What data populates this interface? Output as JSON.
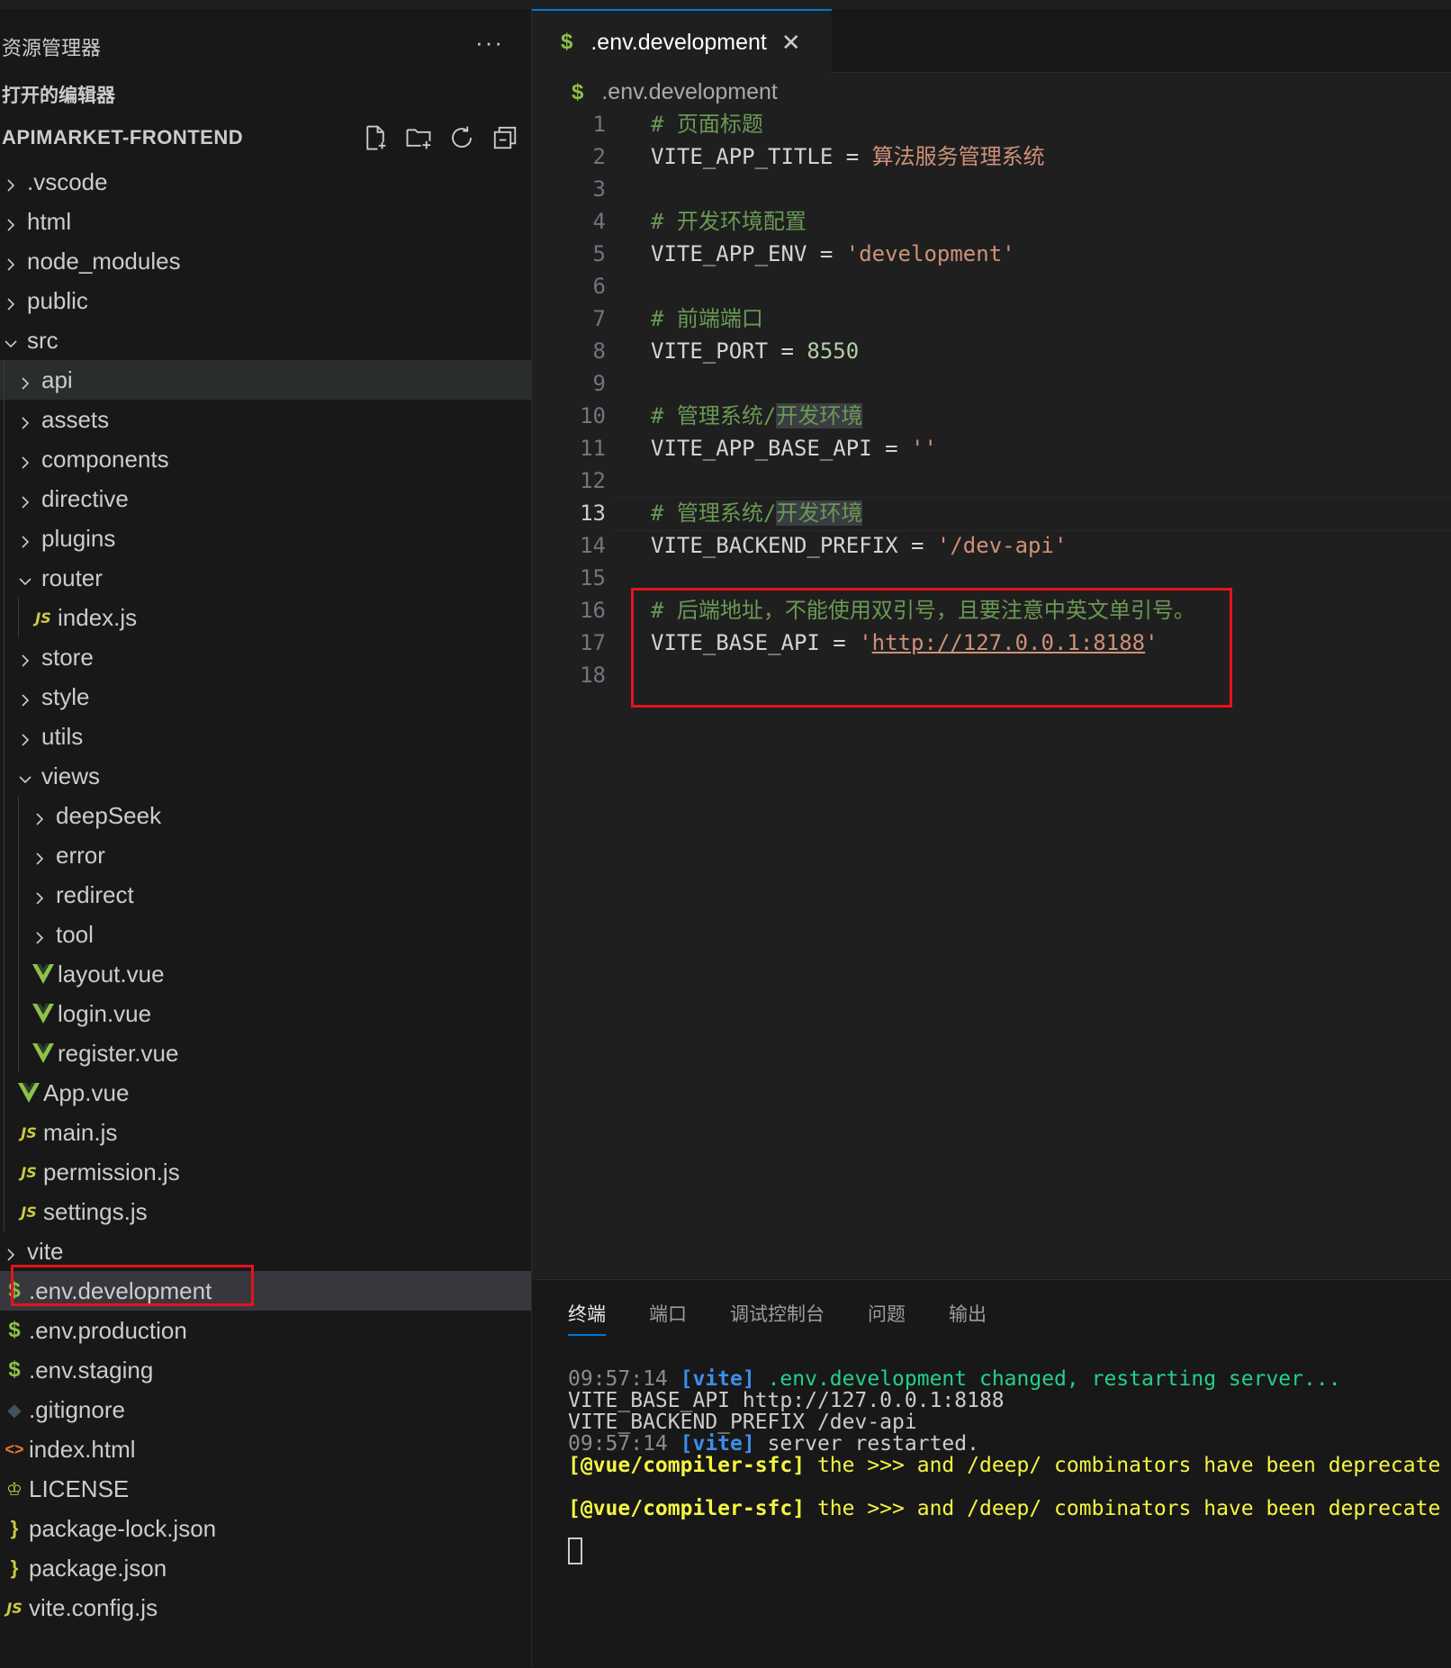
{
  "sidebar": {
    "title": "资源管理器",
    "more": "···",
    "open_editors": "打开的编辑器",
    "project": "APIMARKET-FRONTEND",
    "actions": [
      "new-file-icon",
      "new-folder-icon",
      "refresh-icon",
      "collapse-all-icon"
    ],
    "tree": [
      {
        "label": ".vscode",
        "type": "folder",
        "open": false,
        "depth": 0
      },
      {
        "label": "html",
        "type": "folder",
        "open": false,
        "depth": 0
      },
      {
        "label": "node_modules",
        "type": "folder",
        "open": false,
        "depth": 0
      },
      {
        "label": "public",
        "type": "folder",
        "open": false,
        "depth": 0
      },
      {
        "label": "src",
        "type": "folder",
        "open": true,
        "depth": 0
      },
      {
        "label": "api",
        "type": "folder",
        "open": false,
        "depth": 1,
        "hover": true
      },
      {
        "label": "assets",
        "type": "folder",
        "open": false,
        "depth": 1
      },
      {
        "label": "components",
        "type": "folder",
        "open": false,
        "depth": 1
      },
      {
        "label": "directive",
        "type": "folder",
        "open": false,
        "depth": 1
      },
      {
        "label": "plugins",
        "type": "folder",
        "open": false,
        "depth": 1
      },
      {
        "label": "router",
        "type": "folder",
        "open": true,
        "depth": 1
      },
      {
        "label": "index.js",
        "type": "js",
        "depth": 2
      },
      {
        "label": "store",
        "type": "folder",
        "open": false,
        "depth": 1
      },
      {
        "label": "style",
        "type": "folder",
        "open": false,
        "depth": 1
      },
      {
        "label": "utils",
        "type": "folder",
        "open": false,
        "depth": 1
      },
      {
        "label": "views",
        "type": "folder",
        "open": true,
        "depth": 1
      },
      {
        "label": "deepSeek",
        "type": "folder",
        "open": false,
        "depth": 2
      },
      {
        "label": "error",
        "type": "folder",
        "open": false,
        "depth": 2
      },
      {
        "label": "redirect",
        "type": "folder",
        "open": false,
        "depth": 2
      },
      {
        "label": "tool",
        "type": "folder",
        "open": false,
        "depth": 2
      },
      {
        "label": "layout.vue",
        "type": "vue",
        "depth": 2
      },
      {
        "label": "login.vue",
        "type": "vue",
        "depth": 2
      },
      {
        "label": "register.vue",
        "type": "vue",
        "depth": 2
      },
      {
        "label": "App.vue",
        "type": "vue",
        "depth": 1
      },
      {
        "label": "main.js",
        "type": "js",
        "depth": 1
      },
      {
        "label": "permission.js",
        "type": "js",
        "depth": 1
      },
      {
        "label": "settings.js",
        "type": "js",
        "depth": 1
      },
      {
        "label": "vite",
        "type": "folder",
        "open": false,
        "depth": 0
      },
      {
        "label": ".env.development",
        "type": "env",
        "depth": 0,
        "selected": true
      },
      {
        "label": ".env.production",
        "type": "env",
        "depth": 0
      },
      {
        "label": ".env.staging",
        "type": "env",
        "depth": 0
      },
      {
        "label": ".gitignore",
        "type": "git",
        "depth": 0
      },
      {
        "label": "index.html",
        "type": "html",
        "depth": 0
      },
      {
        "label": "LICENSE",
        "type": "license",
        "depth": 0
      },
      {
        "label": "package-lock.json",
        "type": "json",
        "depth": 0
      },
      {
        "label": "package.json",
        "type": "json",
        "depth": 0
      },
      {
        "label": "vite.config.js",
        "type": "js",
        "depth": 0
      }
    ]
  },
  "editor": {
    "tab_label": ".env.development",
    "tab_close": "✕",
    "breadcrumb": ".env.development",
    "active_line": 13,
    "lines": [
      {
        "n": "1",
        "parts": [
          {
            "c": "cmt",
            "t": "# 页面标题"
          }
        ]
      },
      {
        "n": "2",
        "parts": [
          {
            "c": "key",
            "t": "VITE_APP_TITLE"
          },
          {
            "c": "op",
            "t": " = "
          },
          {
            "c": "str",
            "t": "算法服务管理系统"
          }
        ]
      },
      {
        "n": "3",
        "parts": []
      },
      {
        "n": "4",
        "parts": [
          {
            "c": "cmt",
            "t": "# 开发环境配置"
          }
        ]
      },
      {
        "n": "5",
        "parts": [
          {
            "c": "key",
            "t": "VITE_APP_ENV"
          },
          {
            "c": "op",
            "t": " = "
          },
          {
            "c": "str",
            "t": "'development'"
          }
        ]
      },
      {
        "n": "6",
        "parts": []
      },
      {
        "n": "7",
        "parts": [
          {
            "c": "cmt",
            "t": "# 前端端口"
          }
        ]
      },
      {
        "n": "8",
        "parts": [
          {
            "c": "key",
            "t": "VITE_PORT"
          },
          {
            "c": "op",
            "t": " = "
          },
          {
            "c": "num",
            "t": "8550"
          }
        ]
      },
      {
        "n": "9",
        "parts": []
      },
      {
        "n": "10",
        "parts": [
          {
            "c": "cmt",
            "t": "# 管理系统/"
          },
          {
            "c": "cmt hl",
            "t": "开发环境"
          }
        ]
      },
      {
        "n": "11",
        "parts": [
          {
            "c": "key",
            "t": "VITE_APP_BASE_API"
          },
          {
            "c": "op",
            "t": " = "
          },
          {
            "c": "str",
            "t": "''"
          }
        ]
      },
      {
        "n": "12",
        "parts": []
      },
      {
        "n": "13",
        "parts": [
          {
            "c": "cmt",
            "t": "# 管理系统/"
          },
          {
            "c": "cmt hl",
            "t": "开发环境"
          }
        ]
      },
      {
        "n": "14",
        "parts": [
          {
            "c": "key",
            "t": "VITE_BACKEND_PREFIX"
          },
          {
            "c": "op",
            "t": " = "
          },
          {
            "c": "str",
            "t": "'/dev-api'"
          }
        ]
      },
      {
        "n": "15",
        "parts": []
      },
      {
        "n": "16",
        "parts": [
          {
            "c": "cmt",
            "t": "# 后端地址，不能使用双引号，且要注意中英文单引号。"
          }
        ]
      },
      {
        "n": "17",
        "parts": [
          {
            "c": "key",
            "t": "VITE_BASE_API"
          },
          {
            "c": "op",
            "t": " = "
          },
          {
            "c": "str",
            "t": "'"
          },
          {
            "c": "str url",
            "t": "http://127.0.0.1:8188"
          },
          {
            "c": "str",
            "t": "'"
          }
        ]
      },
      {
        "n": "18",
        "parts": []
      }
    ]
  },
  "panel": {
    "tabs": [
      "终端",
      "端口",
      "调试控制台",
      "问题",
      "输出"
    ],
    "active_tab": 0,
    "terminal": [
      [
        {
          "c": "t-grey",
          "t": "09:57:14 "
        },
        {
          "c": "t-blue",
          "t": "[vite]"
        },
        {
          "c": "t-green",
          "t": " .env.development changed, restarting server..."
        }
      ],
      [
        {
          "c": "",
          "t": "VITE_BASE_API http://127.0.0.1:8188"
        }
      ],
      [
        {
          "c": "",
          "t": "VITE_BACKEND_PREFIX /dev-api"
        }
      ],
      [
        {
          "c": "t-grey",
          "t": "09:57:14 "
        },
        {
          "c": "t-blue",
          "t": "[vite]"
        },
        {
          "c": "",
          "t": " server restarted."
        }
      ],
      [
        {
          "c": "t-yellowb",
          "t": "[@vue/compiler-sfc]"
        },
        {
          "c": "t-yellow",
          "t": " the >>> and /deep/ combinators have been deprecate"
        }
      ],
      [
        {
          "c": "",
          "t": ""
        }
      ],
      [
        {
          "c": "t-yellowb",
          "t": "[@vue/compiler-sfc]"
        },
        {
          "c": "t-yellow",
          "t": " the >>> and /deep/ combinators have been deprecate"
        }
      ]
    ]
  },
  "colors": {
    "accent": "#0078d4",
    "highlight_box": "#e5131d",
    "comment": "#6a9955",
    "string": "#ce9178",
    "number": "#b5cea8"
  }
}
